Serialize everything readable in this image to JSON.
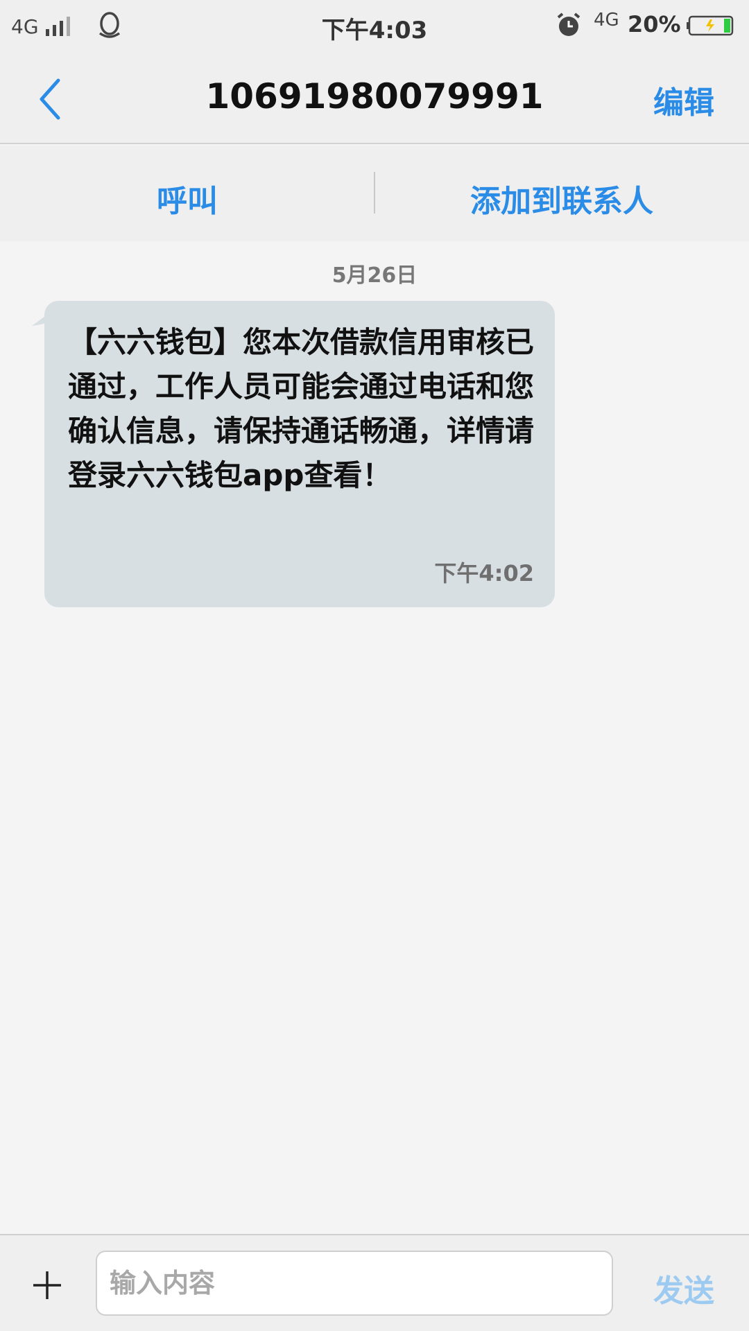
{
  "status_bar": {
    "network": "4G",
    "time": "下午4:03",
    "network_right": "4G",
    "battery_percent": "20%",
    "battery_level": 0.2,
    "icons": [
      "signal-icon",
      "qq-icon",
      "alarm-icon",
      "battery-charging-icon"
    ]
  },
  "header": {
    "title": "10691980079991",
    "edit_label": "编辑",
    "back_icon": "chevron-left-icon"
  },
  "actions": {
    "call_label": "呼叫",
    "add_contact_label": "添加到联系人"
  },
  "conversation": {
    "date": "5月26日",
    "messages": [
      {
        "text": "【六六钱包】您本次借款信用审核已通过，工作人员可能会通过电话和您确认信息，请保持通话畅通，详情请登录六六钱包app查看！",
        "time": "下午4:02"
      }
    ]
  },
  "composer": {
    "placeholder": "输入内容",
    "value": "",
    "send_label": "发送",
    "plus_icon": "plus-icon"
  },
  "colors": {
    "accent": "#2a8ce6",
    "send_disabled": "#9ccaf0",
    "bubble": "#d8dfe2",
    "background": "#f4f4f4"
  }
}
